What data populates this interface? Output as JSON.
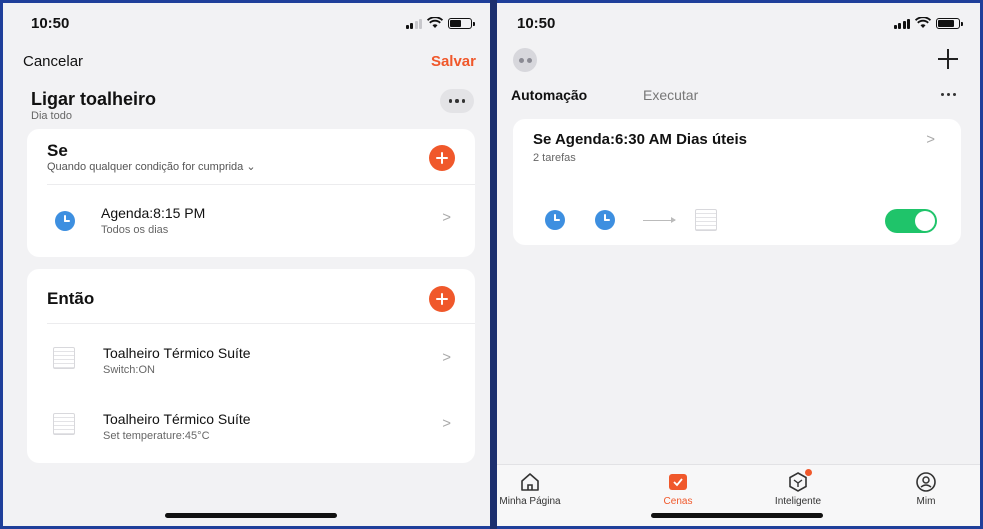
{
  "left_screen": {
    "status_time": "10:50",
    "nav": {
      "cancel_label": "Cancelar",
      "save_label": "Salvar"
    },
    "scene": {
      "title": "Ligar toalheiro",
      "subtitle": "Dia todo"
    },
    "condition_card": {
      "heading": "Se",
      "subheading": "Quando qualquer condição for cumprida ⌄",
      "items": [
        {
          "title": "Agenda:8:15 PM",
          "subtitle": "Todos os dias",
          "icon": "clock-icon"
        }
      ]
    },
    "action_card": {
      "heading": "Então",
      "items": [
        {
          "title": "Toalheiro Térmico Suíte",
          "subtitle": "Switch:ON",
          "icon": "device-icon"
        },
        {
          "title": "Toalheiro Térmico Suíte",
          "subtitle": "Set temperature:45°C",
          "icon": "device-icon"
        }
      ]
    }
  },
  "right_screen": {
    "status_time": "10:50",
    "tabs": [
      {
        "label": "Automação",
        "active": true
      },
      {
        "label": "Executar",
        "active": false
      }
    ],
    "automation": {
      "title": "Se Agenda:6:30 AM Dias úteis",
      "subtitle": "2 tarefas",
      "enabled": true
    },
    "bottom_tabs": [
      {
        "label": "Minha Página",
        "icon": "home-icon",
        "active": false
      },
      {
        "label": "Cenas",
        "icon": "scenes-icon",
        "active": true
      },
      {
        "label": "Inteligente",
        "icon": "smart-icon",
        "active": false
      },
      {
        "label": "Mim",
        "icon": "profile-icon",
        "active": false
      }
    ]
  },
  "colors": {
    "accent": "#f0582b",
    "clock": "#3d8fe0",
    "toggle_on": "#1fc46a",
    "frame": "#1f3f9a"
  },
  "chevron": ">"
}
